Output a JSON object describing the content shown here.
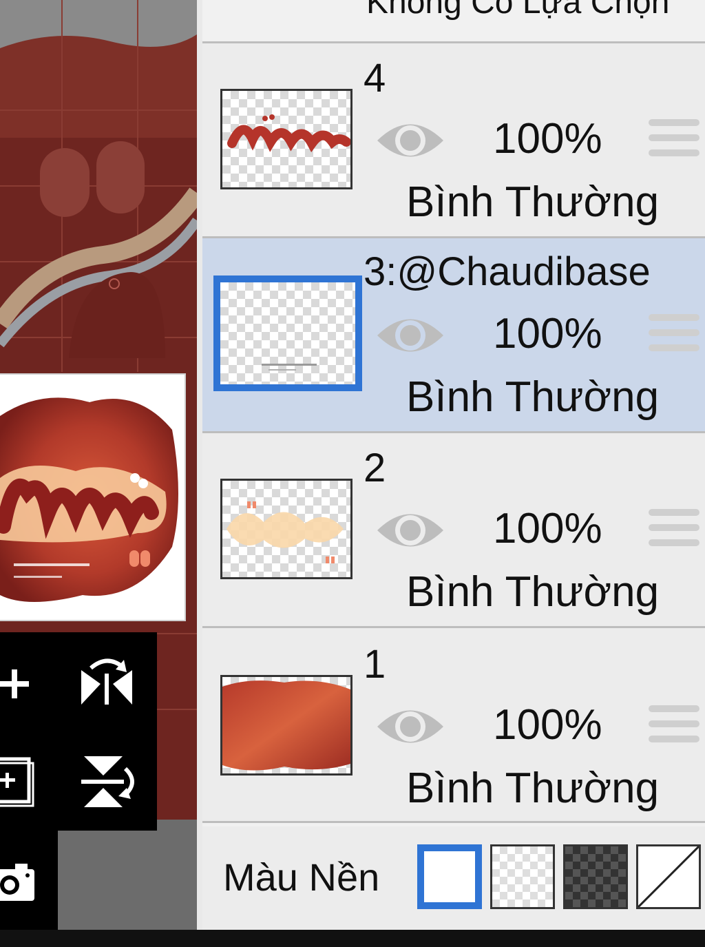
{
  "header": {
    "selection_label": "Không Có Lựa Chọn"
  },
  "layers": [
    {
      "name": "4",
      "opacity": "100%",
      "blend_mode": "Bình Thường",
      "selected": false
    },
    {
      "name": "3:@Chaudibase",
      "opacity": "100%",
      "blend_mode": "Bình Thường",
      "selected": true
    },
    {
      "name": "2",
      "opacity": "100%",
      "blend_mode": "Bình Thường",
      "selected": false
    },
    {
      "name": "1",
      "opacity": "100%",
      "blend_mode": "Bình Thường",
      "selected": false
    }
  ],
  "background": {
    "label": "Màu Nền",
    "swatches": [
      "white",
      "light-checker",
      "dark-checker",
      "none"
    ],
    "active": "white"
  },
  "tools": [
    "add-layer-icon",
    "flip-horizontal-icon",
    "add-image-layer-icon",
    "flip-vertical-icon",
    "camera-icon"
  ],
  "colors": {
    "accent": "#2f74d4",
    "selected_row": "#cbd7ea",
    "row": "#ececec",
    "canvas_bg": "#6e2520"
  }
}
